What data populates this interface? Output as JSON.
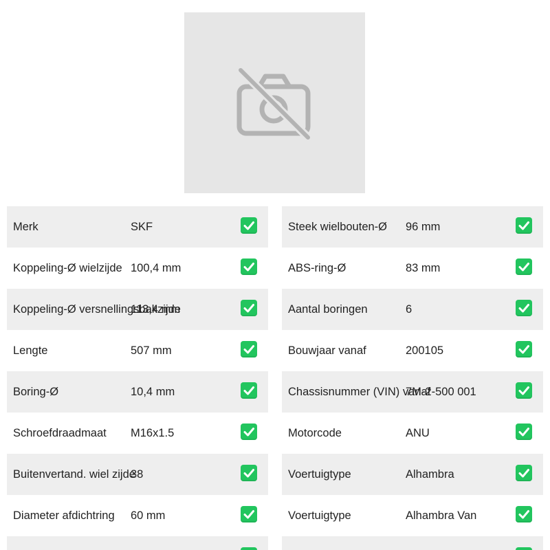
{
  "image_placeholder": {
    "icon": "camera-off-icon"
  },
  "status_color": "#22c55e",
  "left_specs": [
    {
      "label": "Merk",
      "value": "SKF"
    },
    {
      "label": "Koppeling-Ø wielzijde",
      "value": "100,4 mm"
    },
    {
      "label": "Koppeling-Ø versnellingsbakzijde",
      "value": "113,4 mm"
    },
    {
      "label": "Lengte",
      "value": "507 mm"
    },
    {
      "label": "Boring-Ø",
      "value": "10,4 mm"
    },
    {
      "label": "Schroefdraadmaat",
      "value": "M16x1.5"
    },
    {
      "label": "Buitenvertand. wiel zijde",
      "value": "38"
    },
    {
      "label": "Diameter afdichtring",
      "value": "60 mm"
    },
    {
      "label": "",
      "value": ""
    }
  ],
  "right_specs": [
    {
      "label": "Steek wielbouten-Ø",
      "value": "96 mm"
    },
    {
      "label": "ABS-ring-Ø",
      "value": "83 mm"
    },
    {
      "label": "Aantal boringen",
      "value": "6"
    },
    {
      "label": "Bouwjaar vanaf",
      "value": "200105"
    },
    {
      "label": "Chassisnummer (VIN) vanaf",
      "value": "7M-2-500 001"
    },
    {
      "label": "Motorcode",
      "value": "ANU"
    },
    {
      "label": "Voertuigtype",
      "value": "Alhambra"
    },
    {
      "label": "Voertuigtype",
      "value": "Alhambra Van"
    },
    {
      "label": "",
      "value": ""
    }
  ]
}
